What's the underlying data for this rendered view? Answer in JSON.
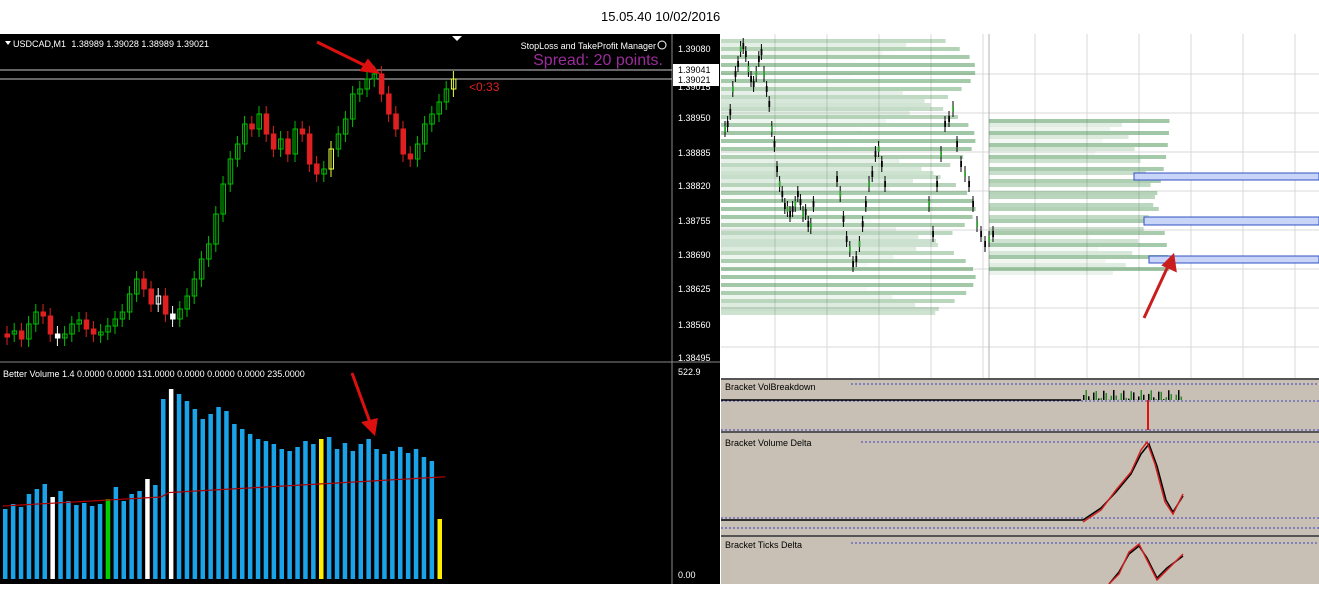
{
  "timestamp": "15.05.40 10/02/2016",
  "main_chart": {
    "symbol_label": "USDCAD,M1",
    "ohlc": "1.38989 1.39028 1.38989 1.39021",
    "ea_name": "StopLoss and TakeProfit Manager",
    "spread_text": "Spread: 20 points.",
    "countdown": "<0:33",
    "price_scale": [
      "1.39080",
      "1.39041",
      "1.39021",
      "1.39015",
      "1.38950",
      "1.38885",
      "1.38820",
      "1.38755",
      "1.38690",
      "1.38625",
      "1.38560",
      "1.38495"
    ],
    "colors": {
      "bull": "#00c000",
      "bear": "#e02020",
      "highlight": "#e8ff40",
      "spike": "#ffffff"
    }
  },
  "volume_panel": {
    "label": "Better Volume 1.4 0.0000 0.0000 131.0000 0.0000 0.0000 0.0000 235.0000",
    "scale_top": "522.9",
    "scale_bottom": "0.00",
    "colors": {
      "bar": "#1aa3e8",
      "climax": "#ffffff",
      "low": "#ffee00",
      "churn": "#00d000",
      "avg_line": "#b00000"
    }
  },
  "right_panels": [
    {
      "title": "Bracket VolBreakdown"
    },
    {
      "title": "Bracket Volume Delta"
    },
    {
      "title": "Bracket Ticks Delta"
    }
  ]
}
